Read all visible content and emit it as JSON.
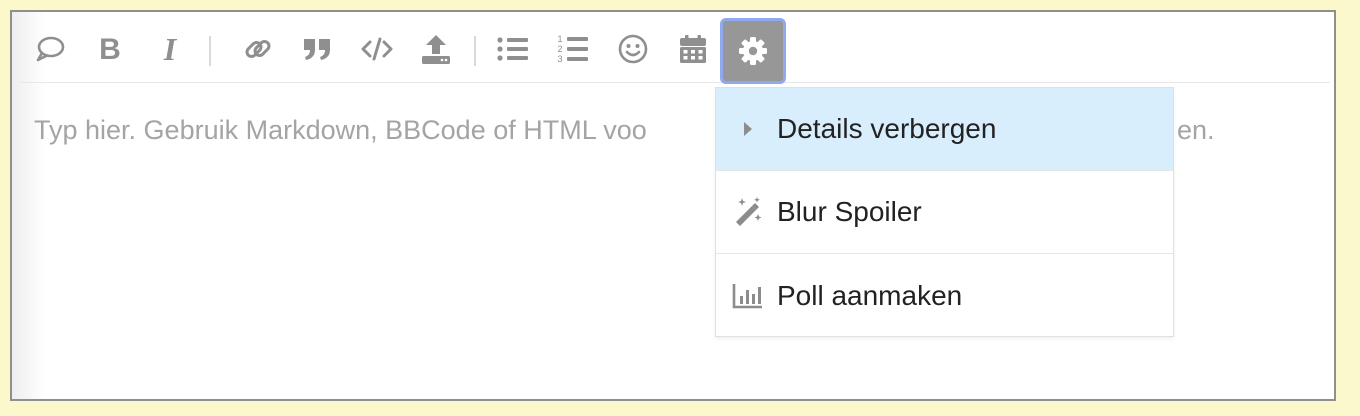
{
  "colors": {
    "page_background": "#fbf8cc",
    "editor_border": "#8f8f8f",
    "icon_gray": "#8f8f8f",
    "active_button": "#979797",
    "focus_ring": "#8fa8ee",
    "highlight_row": "#d9eefc"
  },
  "toolbar": {
    "buttons": [
      {
        "name": "quote-reply",
        "icon": "speech-bubble-icon"
      },
      {
        "name": "bold",
        "icon": "bold-icon"
      },
      {
        "name": "italic",
        "icon": "italic-icon"
      },
      {
        "name": "link",
        "icon": "link-icon"
      },
      {
        "name": "blockquote",
        "icon": "quote-marks-icon"
      },
      {
        "name": "code",
        "icon": "code-icon"
      },
      {
        "name": "upload",
        "icon": "upload-icon"
      },
      {
        "name": "bullet-list",
        "icon": "bullet-list-icon"
      },
      {
        "name": "numbered-list",
        "icon": "numbered-list-icon"
      },
      {
        "name": "emoji",
        "icon": "smiley-icon"
      },
      {
        "name": "insert-date",
        "icon": "calendar-icon"
      },
      {
        "name": "options",
        "icon": "gear-icon",
        "active": true
      }
    ]
  },
  "editor": {
    "placeholder": "Typ hier. Gebruik Markdown, BBCode of HTML voor opmaak. Sleep of plak afbeeldingen."
  },
  "placeholder_visible": {
    "left": "Typ hier. Gebruik Markdown, BBCode of HTML voo",
    "right": "en."
  },
  "options_menu": {
    "items": [
      {
        "label": "Details verbergen",
        "icon": "caret-right-icon",
        "highlighted": true
      },
      {
        "label": "Blur Spoiler",
        "icon": "magic-wand-icon",
        "highlighted": false
      },
      {
        "label": "Poll aanmaken",
        "icon": "bar-chart-icon",
        "highlighted": false
      }
    ]
  }
}
